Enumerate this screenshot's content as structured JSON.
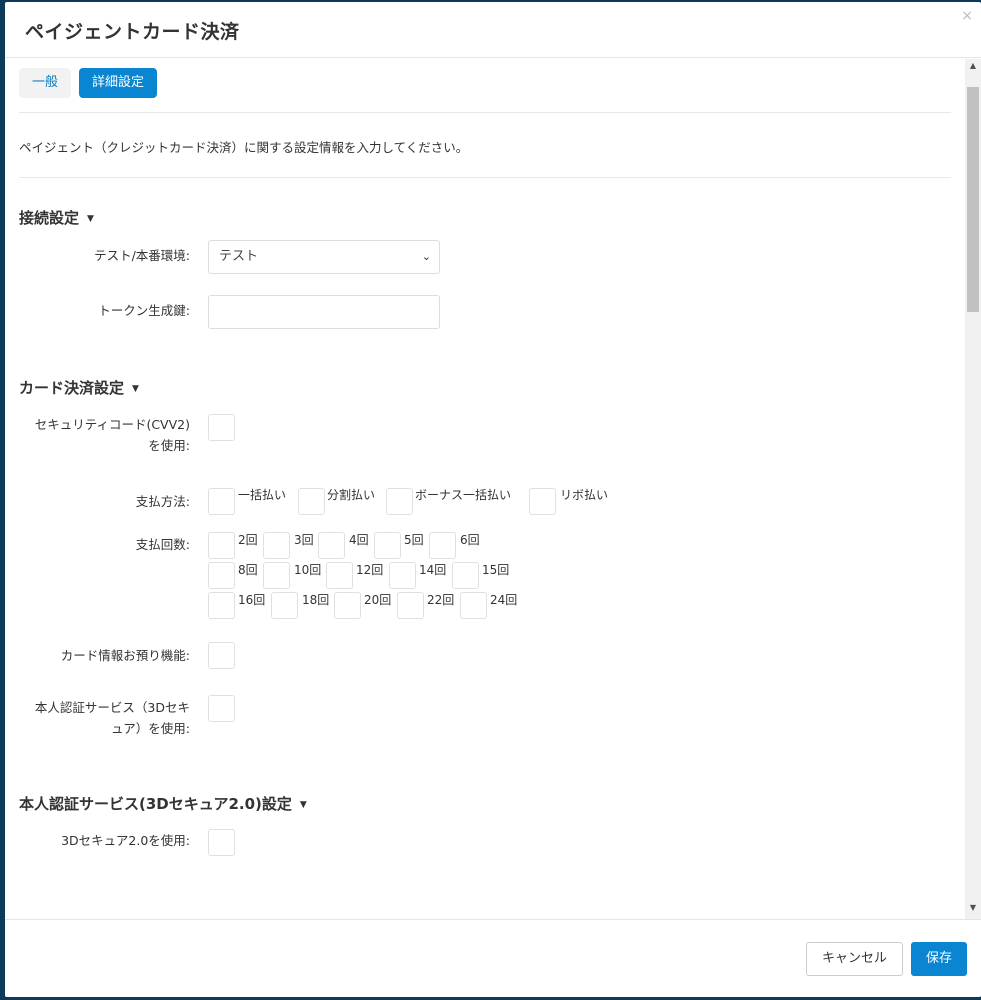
{
  "modal": {
    "title": "ペイジェントカード決済",
    "close_glyph": "×"
  },
  "tabs": [
    {
      "label": "一般",
      "active": false
    },
    {
      "label": "詳細設定",
      "active": true
    }
  ],
  "description": "ペイジェント（クレジットカード決済）に関する設定情報を入力してください。",
  "sections": {
    "connection": {
      "title": "接続設定",
      "env_label": "テスト/本番環境:",
      "env_value": "テスト",
      "token_label": "トークン生成鍵:",
      "token_value": ""
    },
    "card": {
      "title": "カード決済設定",
      "cvv_label_line1": "セキュリティコード(CVV2)",
      "cvv_label_line2": "を使用:",
      "payment_method_label": "支払方法:",
      "payment_methods": [
        "一括払い",
        "分割払い",
        "ボーナス一括払い",
        "リボ払い"
      ],
      "installments_label": "支払回数:",
      "installments": [
        "2回",
        "3回",
        "4回",
        "5回",
        "6回",
        "8回",
        "10回",
        "12回",
        "14回",
        "15回",
        "16回",
        "18回",
        "20回",
        "22回",
        "24回"
      ],
      "card_storage_label": "カード情報お預り機能:",
      "threeds_label_line1": "本人認証サービス（3Dセキ",
      "threeds_label_line2": "ュア）を使用:"
    },
    "threeds2": {
      "title": "本人認証サービス(3Dセキュア2.0)設定",
      "enable_label": "3Dセキュア2.0を使用:"
    }
  },
  "footer": {
    "cancel_label": "キャンセル",
    "save_label": "保存"
  },
  "colors": {
    "primary": "#0a85d1",
    "backdrop": "#0e3a5a"
  },
  "icons": {
    "caret": "▼",
    "chevron": "⌄",
    "scroll_up": "▲",
    "scroll_down": "▼"
  }
}
